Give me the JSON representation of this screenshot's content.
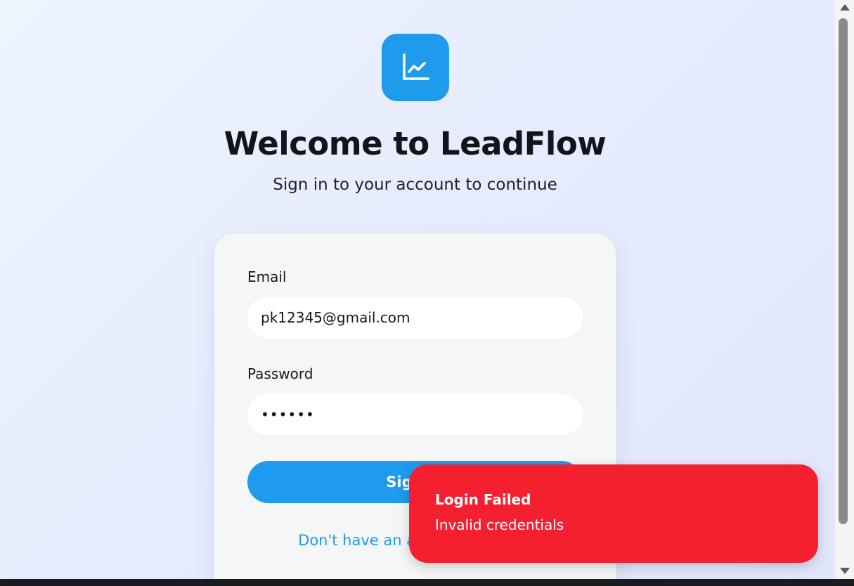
{
  "brand": {
    "logo_icon": "line-chart-icon",
    "accent_color": "#1f9bee"
  },
  "header": {
    "title": "Welcome to LeadFlow",
    "subtitle": "Sign in to your account to continue"
  },
  "form": {
    "email_label": "Email",
    "email_value": "pk12345@gmail.com",
    "password_label": "Password",
    "password_value": "••••••",
    "submit_label": "Sign In",
    "signup_link": "Don't have an account? Sign up"
  },
  "toast": {
    "title": "Login Failed",
    "message": "Invalid credentials",
    "color": "#f4202f"
  }
}
